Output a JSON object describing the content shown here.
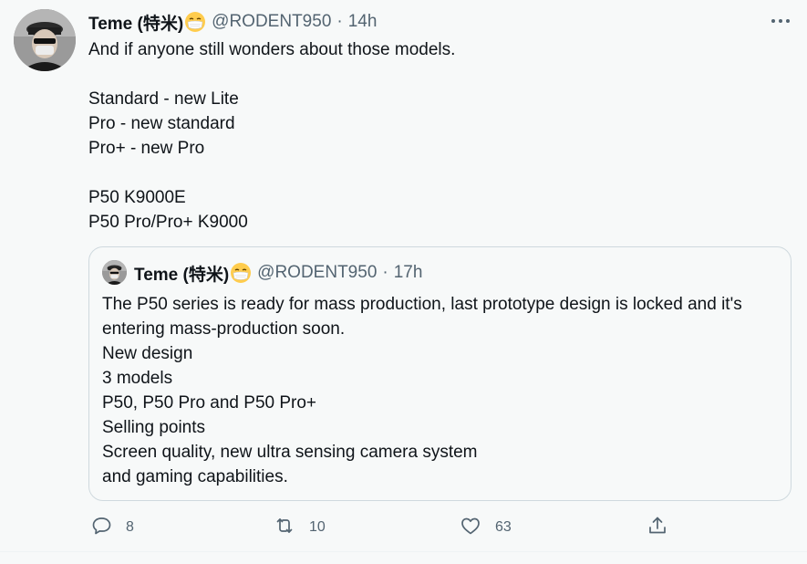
{
  "tweet": {
    "author_name": "Teme (特米)",
    "handle": "@RODENT950",
    "separator": "·",
    "time": "14h",
    "text": "And if anyone still wonders about those models.\n\nStandard - new Lite\nPro - new standard\nPro+ - new Pro\n\nP50 K9000E\nP50 Pro/Pro+ K9000"
  },
  "quoted_tweet": {
    "author_name": "Teme (特米)",
    "handle": "@RODENT950",
    "separator": "·",
    "time": "17h",
    "text": "The P50 series is ready for mass production, last prototype design is locked and it's entering mass-production soon.\nNew design\n3 models\nP50, P50 Pro and P50 Pro+\nSelling points\nScreen quality, new ultra sensing camera system\nand gaming capabilities."
  },
  "actions": {
    "reply": {
      "icon": "reply-icon",
      "count": "8"
    },
    "retweet": {
      "icon": "retweet-icon",
      "count": "10"
    },
    "like": {
      "icon": "heart-icon",
      "count": "63"
    },
    "share": {
      "icon": "share-icon"
    }
  },
  "colors": {
    "background": "#f7f9f9",
    "text_primary": "#0f1419",
    "text_secondary": "#536471",
    "border": "#cfd9de"
  }
}
